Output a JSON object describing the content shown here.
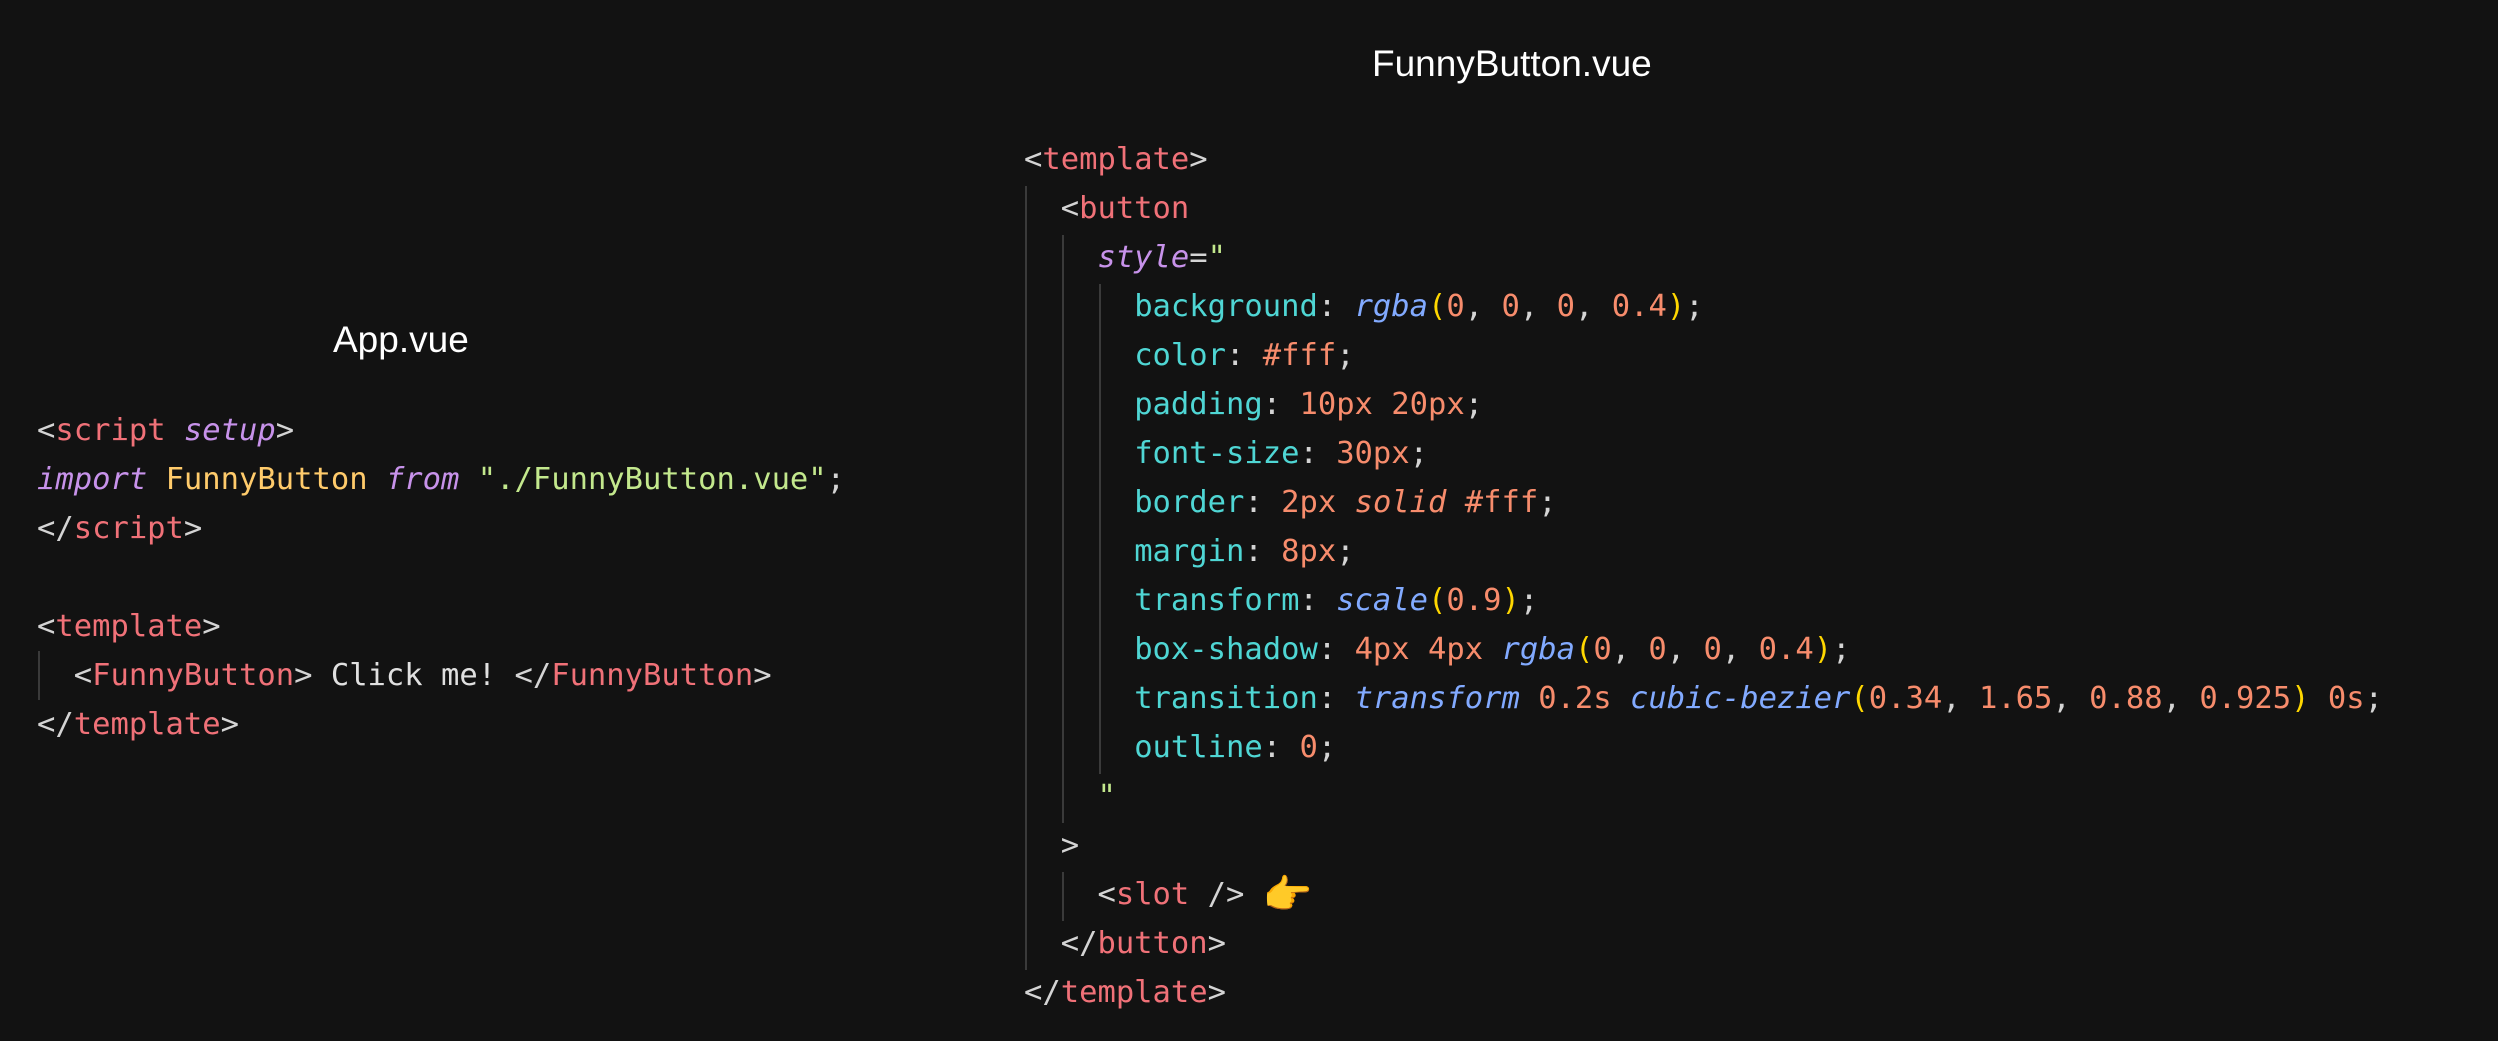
{
  "app_panel": {
    "title": "App.vue",
    "code": [
      [
        [
          "punct",
          "<"
        ],
        [
          "tag",
          "script"
        ],
        [
          "punct",
          " "
        ],
        [
          "attr",
          "setup"
        ],
        [
          "punct",
          ">"
        ]
      ],
      [
        [
          "kw",
          "import"
        ],
        [
          "punct",
          " "
        ],
        [
          "ident",
          "FunnyButton"
        ],
        [
          "punct",
          " "
        ],
        [
          "kw",
          "from"
        ],
        [
          "punct",
          " "
        ],
        [
          "str",
          "\"./FunnyButton.vue\""
        ],
        [
          "punct",
          ";"
        ]
      ],
      [
        [
          "punct",
          "</"
        ],
        [
          "tag",
          "script"
        ],
        [
          "punct",
          ">"
        ]
      ],
      [],
      [
        [
          "punct",
          "<"
        ],
        [
          "tag",
          "template"
        ],
        [
          "punct",
          ">"
        ]
      ],
      [
        [
          "punct",
          "  <"
        ],
        [
          "tag",
          "FunnyButton"
        ],
        [
          "punct",
          ">"
        ],
        [
          "text",
          " Click me! "
        ],
        [
          "punct",
          "</"
        ],
        [
          "tag",
          "FunnyButton"
        ],
        [
          "punct",
          ">"
        ]
      ],
      [
        [
          "punct",
          "</"
        ],
        [
          "tag",
          "template"
        ],
        [
          "punct",
          ">"
        ]
      ]
    ]
  },
  "funny_panel": {
    "title": "FunnyButton.vue",
    "code": [
      [
        [
          "punct",
          "<"
        ],
        [
          "tag",
          "template"
        ],
        [
          "punct",
          ">"
        ]
      ],
      [
        [
          "punct",
          "  <"
        ],
        [
          "tag",
          "button"
        ]
      ],
      [
        [
          "punct",
          "    "
        ],
        [
          "attr",
          "style"
        ],
        [
          "punct",
          "="
        ],
        [
          "str",
          "\""
        ]
      ],
      [
        [
          "punct",
          "      "
        ],
        [
          "prop",
          "background"
        ],
        [
          "punct",
          ": "
        ],
        [
          "fn",
          "rgba"
        ],
        [
          "paren",
          "("
        ],
        [
          "num",
          "0"
        ],
        [
          "punct",
          ", "
        ],
        [
          "num",
          "0"
        ],
        [
          "punct",
          ", "
        ],
        [
          "num",
          "0"
        ],
        [
          "punct",
          ", "
        ],
        [
          "num",
          "0.4"
        ],
        [
          "paren",
          ")"
        ],
        [
          "punct",
          ";"
        ]
      ],
      [
        [
          "punct",
          "      "
        ],
        [
          "prop",
          "color"
        ],
        [
          "punct",
          ": "
        ],
        [
          "num",
          "#fff"
        ],
        [
          "punct",
          ";"
        ]
      ],
      [
        [
          "punct",
          "      "
        ],
        [
          "prop",
          "padding"
        ],
        [
          "punct",
          ": "
        ],
        [
          "num",
          "10px 20px"
        ],
        [
          "punct",
          ";"
        ]
      ],
      [
        [
          "punct",
          "      "
        ],
        [
          "prop",
          "font-size"
        ],
        [
          "punct",
          ": "
        ],
        [
          "num",
          "30px"
        ],
        [
          "punct",
          ";"
        ]
      ],
      [
        [
          "punct",
          "      "
        ],
        [
          "prop",
          "border"
        ],
        [
          "punct",
          ": "
        ],
        [
          "num",
          "2px"
        ],
        [
          "punct",
          " "
        ],
        [
          "italic",
          "solid"
        ],
        [
          "punct",
          " "
        ],
        [
          "num",
          "#fff"
        ],
        [
          "punct",
          ";"
        ]
      ],
      [
        [
          "punct",
          "      "
        ],
        [
          "prop",
          "margin"
        ],
        [
          "punct",
          ": "
        ],
        [
          "num",
          "8px"
        ],
        [
          "punct",
          ";"
        ]
      ],
      [
        [
          "punct",
          "      "
        ],
        [
          "prop",
          "transform"
        ],
        [
          "punct",
          ": "
        ],
        [
          "fn",
          "scale"
        ],
        [
          "paren",
          "("
        ],
        [
          "num",
          "0.9"
        ],
        [
          "paren",
          ")"
        ],
        [
          "punct",
          ";"
        ]
      ],
      [
        [
          "punct",
          "      "
        ],
        [
          "prop",
          "box-shadow"
        ],
        [
          "punct",
          ": "
        ],
        [
          "num",
          "4px 4px"
        ],
        [
          "punct",
          " "
        ],
        [
          "fn",
          "rgba"
        ],
        [
          "paren",
          "("
        ],
        [
          "num",
          "0"
        ],
        [
          "punct",
          ", "
        ],
        [
          "num",
          "0"
        ],
        [
          "punct",
          ", "
        ],
        [
          "num",
          "0"
        ],
        [
          "punct",
          ", "
        ],
        [
          "num",
          "0.4"
        ],
        [
          "paren",
          ")"
        ],
        [
          "punct",
          ";"
        ]
      ],
      [
        [
          "punct",
          "      "
        ],
        [
          "prop",
          "transition"
        ],
        [
          "punct",
          ": "
        ],
        [
          "italic-blue",
          "transform"
        ],
        [
          "punct",
          " "
        ],
        [
          "num",
          "0.2s"
        ],
        [
          "punct",
          " "
        ],
        [
          "fn",
          "cubic-bezier"
        ],
        [
          "paren",
          "("
        ],
        [
          "num",
          "0.34"
        ],
        [
          "punct",
          ", "
        ],
        [
          "num",
          "1.65"
        ],
        [
          "punct",
          ", "
        ],
        [
          "num",
          "0.88"
        ],
        [
          "punct",
          ", "
        ],
        [
          "num",
          "0.925"
        ],
        [
          "paren",
          ")"
        ],
        [
          "punct",
          " "
        ],
        [
          "num",
          "0s"
        ],
        [
          "punct",
          ";"
        ]
      ],
      [
        [
          "punct",
          "      "
        ],
        [
          "prop",
          "outline"
        ],
        [
          "punct",
          ": "
        ],
        [
          "num",
          "0"
        ],
        [
          "punct",
          ";"
        ]
      ],
      [
        [
          "punct",
          "    "
        ],
        [
          "str",
          "\""
        ]
      ],
      [
        [
          "punct",
          "  >"
        ]
      ],
      [
        [
          "punct",
          "    <"
        ],
        [
          "tag",
          "slot"
        ],
        [
          "punct",
          " />"
        ],
        [
          "punct",
          " "
        ],
        [
          "emoji",
          "👉"
        ]
      ],
      [
        [
          "punct",
          "  </"
        ],
        [
          "tag",
          "button"
        ],
        [
          "punct",
          ">"
        ]
      ],
      [
        [
          "punct",
          "</"
        ],
        [
          "tag",
          "template"
        ],
        [
          "punct",
          ">"
        ]
      ]
    ]
  }
}
